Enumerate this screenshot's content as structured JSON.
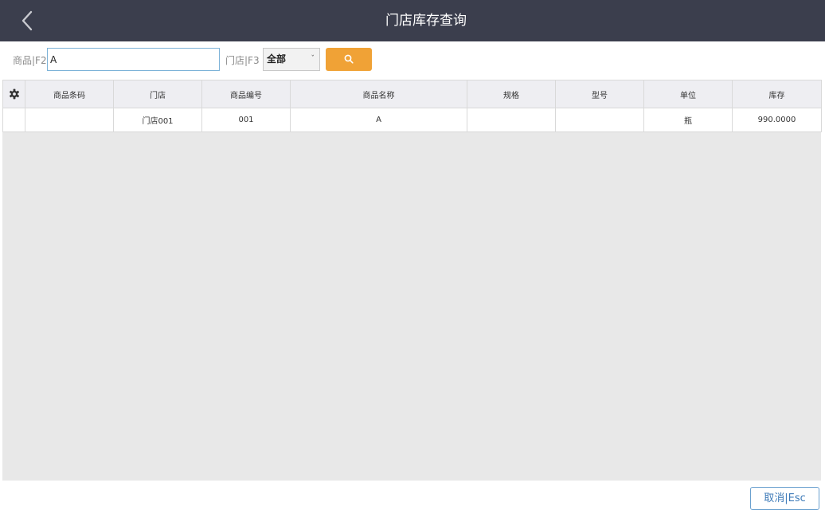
{
  "header": {
    "title": "门店库存查询",
    "back_icon": "chevron-left-icon"
  },
  "filters": {
    "product_label": "商品|F2",
    "product_value": "A",
    "store_label": "门店|F3",
    "store_selected": "全部",
    "search_icon": "search-icon"
  },
  "table": {
    "settings_icon": "gear-icon",
    "columns": [
      "商品条码",
      "门店",
      "商品编号",
      "商品名称",
      "规格",
      "型号",
      "单位",
      "库存"
    ],
    "rows": [
      {
        "barcode": "",
        "store": "门店001",
        "code": "001",
        "name": "A",
        "spec": "",
        "model": "",
        "unit": "瓶",
        "stock": "990.0000"
      }
    ]
  },
  "footer": {
    "cancel_label": "取消|Esc"
  },
  "colors": {
    "topbar": "#3b3e4d",
    "search_button": "#f0a236",
    "cancel_border": "#6aa0cf"
  }
}
